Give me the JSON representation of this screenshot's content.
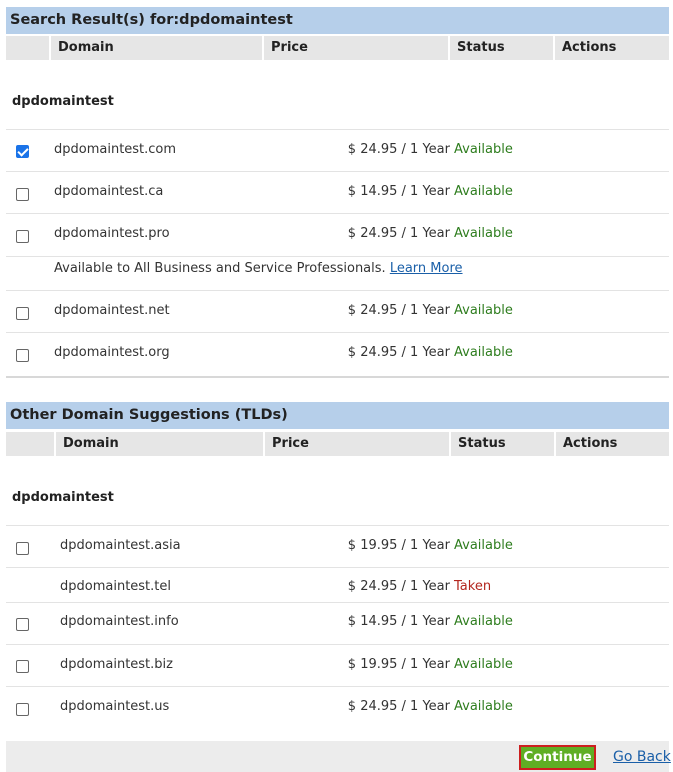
{
  "section1": {
    "title": "Search Result(s) for:dpdomaintest",
    "columns": [
      "Domain",
      "Price",
      "Status",
      "Actions"
    ],
    "group_label": "dpdomaintest",
    "rows": [
      {
        "domain": "dpdomaintest.com",
        "price": "$ 24.95 / 1 Year",
        "status": "Available",
        "checked": true
      },
      {
        "domain": "dpdomaintest.ca",
        "price": "$ 14.95 / 1 Year",
        "status": "Available",
        "checked": false
      },
      {
        "domain": "dpdomaintest.pro",
        "price": "$ 24.95 / 1 Year",
        "status": "Available",
        "checked": false
      },
      {
        "domain": "dpdomaintest.net",
        "price": "$ 24.95 / 1 Year",
        "status": "Available",
        "checked": false
      },
      {
        "domain": "dpdomaintest.org",
        "price": "$ 24.95 / 1 Year",
        "status": "Available",
        "checked": false
      }
    ],
    "pro_note": "Available to All Business and Service Professionals.",
    "learn_more": "Learn More"
  },
  "section2": {
    "title": "Other Domain Suggestions (TLDs)",
    "columns": [
      "Domain",
      "Price",
      "Status",
      "Actions"
    ],
    "group_label": "dpdomaintest",
    "rows": [
      {
        "domain": "dpdomaintest.asia",
        "price": "$ 19.95 / 1 Year",
        "status": "Available",
        "checked": false
      },
      {
        "domain": "dpdomaintest.tel",
        "price": "$ 24.95 / 1 Year",
        "status": "Taken",
        "checked": false
      },
      {
        "domain": "dpdomaintest.info",
        "price": "$ 14.95 / 1 Year",
        "status": "Available",
        "checked": false
      },
      {
        "domain": "dpdomaintest.biz",
        "price": "$ 19.95 / 1 Year",
        "status": "Available",
        "checked": false
      },
      {
        "domain": "dpdomaintest.us",
        "price": "$ 24.95 / 1 Year",
        "status": "Available",
        "checked": false
      }
    ]
  },
  "footer": {
    "continue_label": "Continue",
    "go_back_label": "Go Back"
  },
  "colors": {
    "header_bg": "#b6cfea",
    "available": "#2e7d1e",
    "taken": "#b3261e",
    "continue_bg": "#5fae24",
    "continue_border": "#cc1f1f"
  }
}
